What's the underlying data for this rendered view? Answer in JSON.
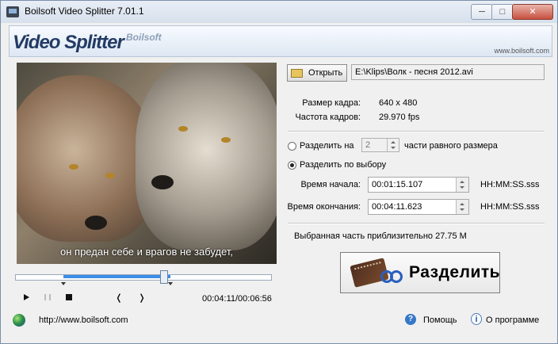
{
  "window": {
    "title": "Boilsoft Video Splitter 7.01.1",
    "min_symbol": "─",
    "max_symbol": "□",
    "close_symbol": "✕"
  },
  "banner": {
    "product_name": "Video Splitter",
    "company": "Boilsoft",
    "url": "www.boilsoft.com"
  },
  "player": {
    "subtitle": "он предан себе и врагов не забудет,",
    "progress": 0.58,
    "selection_start": 0.19,
    "selection_end": 0.61,
    "time_display": "00:04:11/00:06:56",
    "prev_symbol": "❬",
    "next_symbol": "❭"
  },
  "file": {
    "open_label": "Открыть",
    "path": "E:\\Klips\\Волк - песня 2012.avi",
    "frame_size_label": "Размер кадра:",
    "frame_size_value": "640 x 480",
    "frame_rate_label": "Частота кадров:",
    "frame_rate_value": "29.970 fps"
  },
  "split_options": {
    "split_into_label": "Разделить на",
    "parts_value": "2",
    "equal_parts_label": "части равного размера",
    "split_selection_label": "Разделить по выбору",
    "selected_mode": "selection"
  },
  "times": {
    "start_label": "Время начала:",
    "start_value": "00:01:15.107",
    "end_label": "Время окончания:",
    "end_value": "00:04:11.623",
    "format": "HH:MM:SS.sss"
  },
  "summary": {
    "selected_size_text": "Выбранная часть приблизительно 27.75 М"
  },
  "actions": {
    "split_label": "Разделить"
  },
  "footer": {
    "site_link": "http://www.boilsoft.com",
    "help_label": "Помощь",
    "about_label": "О программе",
    "help_symbol": "?",
    "info_symbol": "i"
  }
}
